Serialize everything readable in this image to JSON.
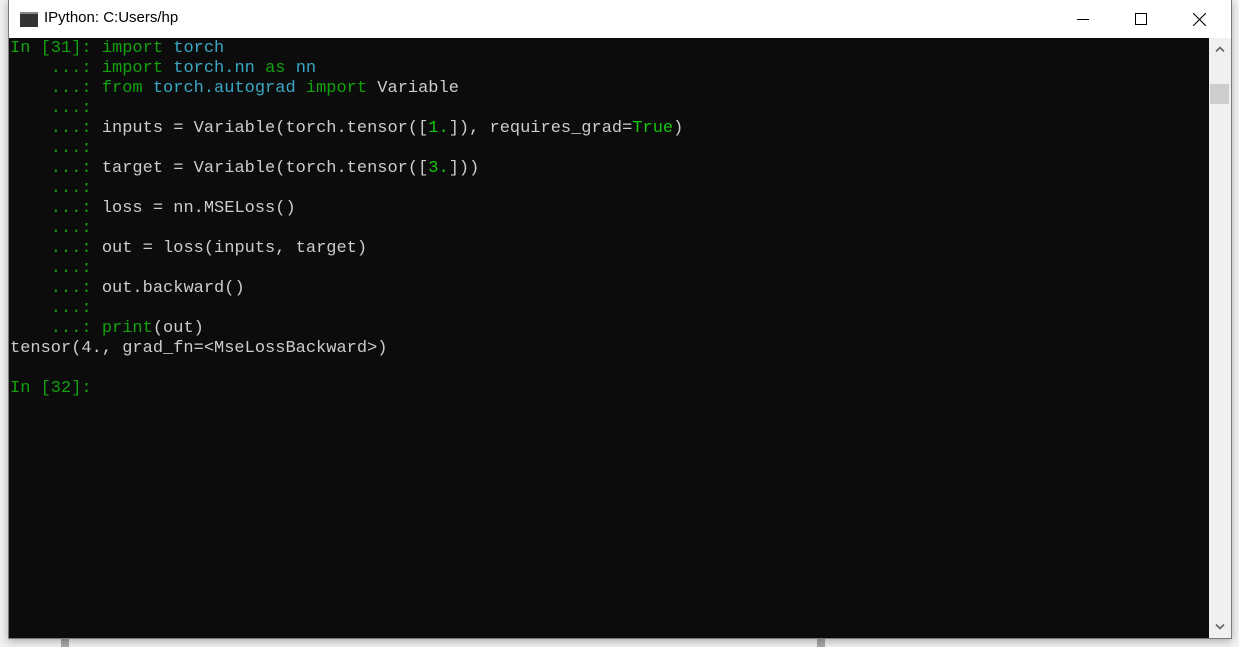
{
  "window": {
    "title": "IPython: C:Users/hp",
    "icon": "console-icon",
    "controls": {
      "minimize": "minimize-icon",
      "maximize": "maximize-icon",
      "close": "close-icon"
    }
  },
  "colors": {
    "console_bg": "#0c0c0c",
    "default_text": "#cccccc",
    "prompt_green": "#13a10e",
    "keyword_green": "#13a10e",
    "module_cyan": "#3ba7c4",
    "literal_green": "#16c60c"
  },
  "console": {
    "lines": [
      [
        {
          "t": "In [31]: ",
          "s": "g"
        },
        {
          "t": "import",
          "s": "g"
        },
        {
          "t": " "
        },
        {
          "t": "torch",
          "s": "c"
        }
      ],
      [
        {
          "t": "    ...: ",
          "s": "g"
        },
        {
          "t": "import",
          "s": "g"
        },
        {
          "t": " "
        },
        {
          "t": "torch.nn",
          "s": "c"
        },
        {
          "t": " "
        },
        {
          "t": "as",
          "s": "g"
        },
        {
          "t": " "
        },
        {
          "t": "nn",
          "s": "c"
        }
      ],
      [
        {
          "t": "    ...: ",
          "s": "g"
        },
        {
          "t": "from",
          "s": "g"
        },
        {
          "t": " "
        },
        {
          "t": "torch.autograd",
          "s": "c"
        },
        {
          "t": " "
        },
        {
          "t": "import",
          "s": "g"
        },
        {
          "t": " Variable"
        }
      ],
      [
        {
          "t": "    ...:",
          "s": "g"
        }
      ],
      [
        {
          "t": "    ...: ",
          "s": "g"
        },
        {
          "t": "inputs = Variable(torch.tensor(["
        },
        {
          "t": "1.",
          "s": "gl"
        },
        {
          "t": "]), requires_grad="
        },
        {
          "t": "True",
          "s": "gl"
        },
        {
          "t": ")"
        }
      ],
      [
        {
          "t": "    ...:",
          "s": "g"
        }
      ],
      [
        {
          "t": "    ...: ",
          "s": "g"
        },
        {
          "t": "target = Variable(torch.tensor(["
        },
        {
          "t": "3.",
          "s": "gl"
        },
        {
          "t": "]))"
        }
      ],
      [
        {
          "t": "    ...:",
          "s": "g"
        }
      ],
      [
        {
          "t": "    ...: ",
          "s": "g"
        },
        {
          "t": "loss = nn.MSELoss()"
        }
      ],
      [
        {
          "t": "    ...:",
          "s": "g"
        }
      ],
      [
        {
          "t": "    ...: ",
          "s": "g"
        },
        {
          "t": "out = loss(inputs, target)"
        }
      ],
      [
        {
          "t": "    ...:",
          "s": "g"
        }
      ],
      [
        {
          "t": "    ...: ",
          "s": "g"
        },
        {
          "t": "out.backward()"
        }
      ],
      [
        {
          "t": "    ...:",
          "s": "g"
        }
      ],
      [
        {
          "t": "    ...: ",
          "s": "g"
        },
        {
          "t": "print",
          "s": "g"
        },
        {
          "t": "(out)"
        }
      ],
      [
        {
          "t": "tensor(4., grad_fn=<MseLossBackward>)"
        }
      ],
      [
        {
          "t": ""
        }
      ],
      [
        {
          "t": "In [32]: ",
          "s": "g"
        }
      ]
    ]
  },
  "scrollbar": {
    "up": "chevron-up-icon",
    "down": "chevron-down-icon",
    "position": 0.0
  }
}
